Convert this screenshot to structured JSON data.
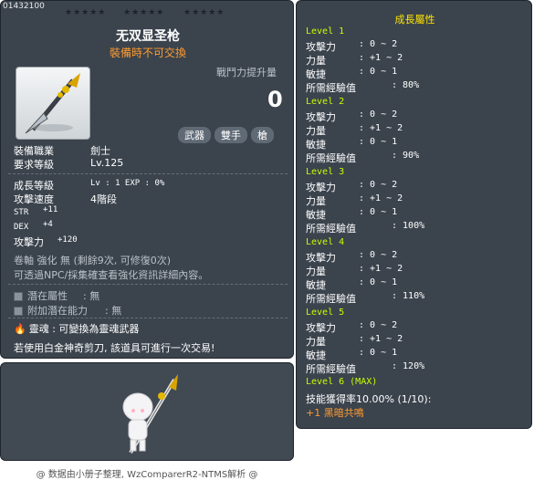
{
  "item": {
    "id": "01432100",
    "name": "无双显圣枪",
    "trade_note": "裝備時不可交換",
    "power_label": "戰鬥力提升量",
    "power_value": "0",
    "tags": [
      "武器",
      "雙手",
      "槍"
    ]
  },
  "stats": {
    "job_label": "裝備職業",
    "job_value": "劍士",
    "req_label": "要求等級",
    "req_value": "Lv.125",
    "growth_label": "成長等級",
    "growth_value": "Lv  :  1   EXP  :  0%",
    "speed_label": "攻擊速度",
    "speed_value": "4階段",
    "str_label": "STR",
    "str_value": "+11",
    "dex_label": "DEX",
    "dex_value": "+4",
    "atk_label": "攻擊力",
    "atk_value": "+120",
    "scroll_text": "卷軸 強化 無 (剩餘9次, 可修復0次)",
    "enhance_text": "可透過NPC/採集確查看強化資訊詳細內容。",
    "potential_label": "潛在屬性",
    "potential_value": ":  無",
    "bonus_potential_label": "附加潛在能力",
    "bonus_potential_value": ":  無",
    "soul_label": "靈魂",
    "soul_value": ": 可變換為靈魂武器",
    "scissors_text": "若使用白金神奇剪刀, 該道具可進行一次交易!"
  },
  "growth": {
    "title": "成長屬性",
    "levels": [
      {
        "level": "Level 1",
        "atk_label": "攻擊力",
        "atk": ": 0 ~ 2",
        "str_label": "力量",
        "str": ": +1 ~ 2",
        "dex_label": "敏捷",
        "dex": ": 0 ~ 1",
        "exp_label": "所需經驗值",
        "exp": ": 80%"
      },
      {
        "level": "Level 2",
        "atk_label": "攻擊力",
        "atk": ": 0 ~ 2",
        "str_label": "力量",
        "str": ": +1 ~ 2",
        "dex_label": "敏捷",
        "dex": ": 0 ~ 1",
        "exp_label": "所需經驗值",
        "exp": ": 90%"
      },
      {
        "level": "Level 3",
        "atk_label": "攻擊力",
        "atk": ": 0 ~ 2",
        "str_label": "力量",
        "str": ": +1 ~ 2",
        "dex_label": "敏捷",
        "dex": ": 0 ~ 1",
        "exp_label": "所需經驗值",
        "exp": ": 100%"
      },
      {
        "level": "Level 4",
        "atk_label": "攻擊力",
        "atk": ": 0 ~ 2",
        "str_label": "力量",
        "str": ": +1 ~ 2",
        "dex_label": "敏捷",
        "dex": ": 0 ~ 1",
        "exp_label": "所需經驗值",
        "exp": ": 110%"
      },
      {
        "level": "Level 5",
        "atk_label": "攻擊力",
        "atk": ": 0 ~ 2",
        "str_label": "力量",
        "str": ": +1 ~ 2",
        "dex_label": "敏捷",
        "dex": ": 0 ~ 1",
        "exp_label": "所需經驗值",
        "exp": ": 120%"
      }
    ],
    "level6": "Level 6 (MAX)",
    "skill_text": "技能獲得率10.00% (1/10):",
    "skill_value": "+1 黑暗共鳴"
  },
  "footer": "@ 数据由小册子整理, WzComparerR2-NTMS解析 @",
  "colors": {
    "panel": "#3b434d",
    "accent_yellow": "#ffe400",
    "accent_green": "#c6ff00",
    "accent_orange": "#ff9b2f"
  }
}
